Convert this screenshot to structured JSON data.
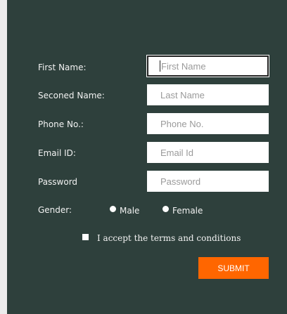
{
  "form": {
    "fields": [
      {
        "label": "First Name:",
        "placeholder": "First Name"
      },
      {
        "label": "Seconed Name:",
        "placeholder": "Last Name"
      },
      {
        "label": "Phone No.:",
        "placeholder": "Phone No."
      },
      {
        "label": "Email ID:",
        "placeholder": "Email Id"
      },
      {
        "label": "Password",
        "placeholder": "Password"
      }
    ],
    "gender": {
      "label": "Gender:",
      "options": [
        "Male",
        "Female"
      ]
    },
    "terms_label": "I accept the terms and conditions",
    "submit_label": "SUBMIT"
  },
  "colors": {
    "panel_background": "#2e403c",
    "page_background": "#ececec",
    "submit_background": "#ff6600",
    "text": "#f2f2f2"
  }
}
